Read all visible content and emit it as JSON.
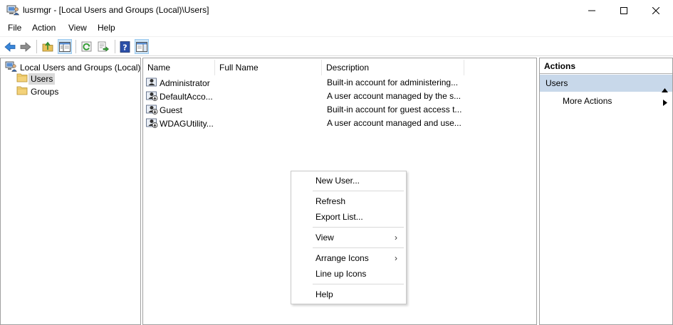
{
  "window": {
    "title": "lusrmgr - [Local Users and Groups (Local)\\Users]",
    "icon": "computer-users-icon"
  },
  "menubar": {
    "items": [
      "File",
      "Action",
      "View",
      "Help"
    ]
  },
  "toolbar": {
    "buttons": [
      "back-arrow-icon",
      "forward-arrow-icon",
      "up-folder-icon",
      "show-hide-console-tree-icon",
      "refresh-icon",
      "export-list-icon",
      "help-icon",
      "show-hide-action-pane-icon"
    ]
  },
  "tree": {
    "root": "Local Users and Groups (Local)",
    "children": [
      "Users",
      "Groups"
    ],
    "selected": "Users"
  },
  "list": {
    "columns": [
      "Name",
      "Full Name",
      "Description"
    ],
    "rows": [
      {
        "name": "Administrator",
        "full_name": "",
        "description": "Built-in account for administering..."
      },
      {
        "name": "DefaultAcco...",
        "full_name": "",
        "description": "A user account managed by the s..."
      },
      {
        "name": "Guest",
        "full_name": "",
        "description": "Built-in account for guest access t..."
      },
      {
        "name": "WDAGUtility...",
        "full_name": "",
        "description": "A user account managed and use..."
      }
    ]
  },
  "context_menu": {
    "items": [
      "New User...",
      "Refresh",
      "Export List...",
      "View",
      "Arrange Icons",
      "Line up Icons",
      "Help"
    ]
  },
  "actions": {
    "title": "Actions",
    "section": "Users",
    "more": "More Actions"
  },
  "colors": {
    "selection_bg": "#cce4f7",
    "actions_section_bg": "#c8d8ea",
    "tree_selected_bg": "#d9d9d9"
  }
}
